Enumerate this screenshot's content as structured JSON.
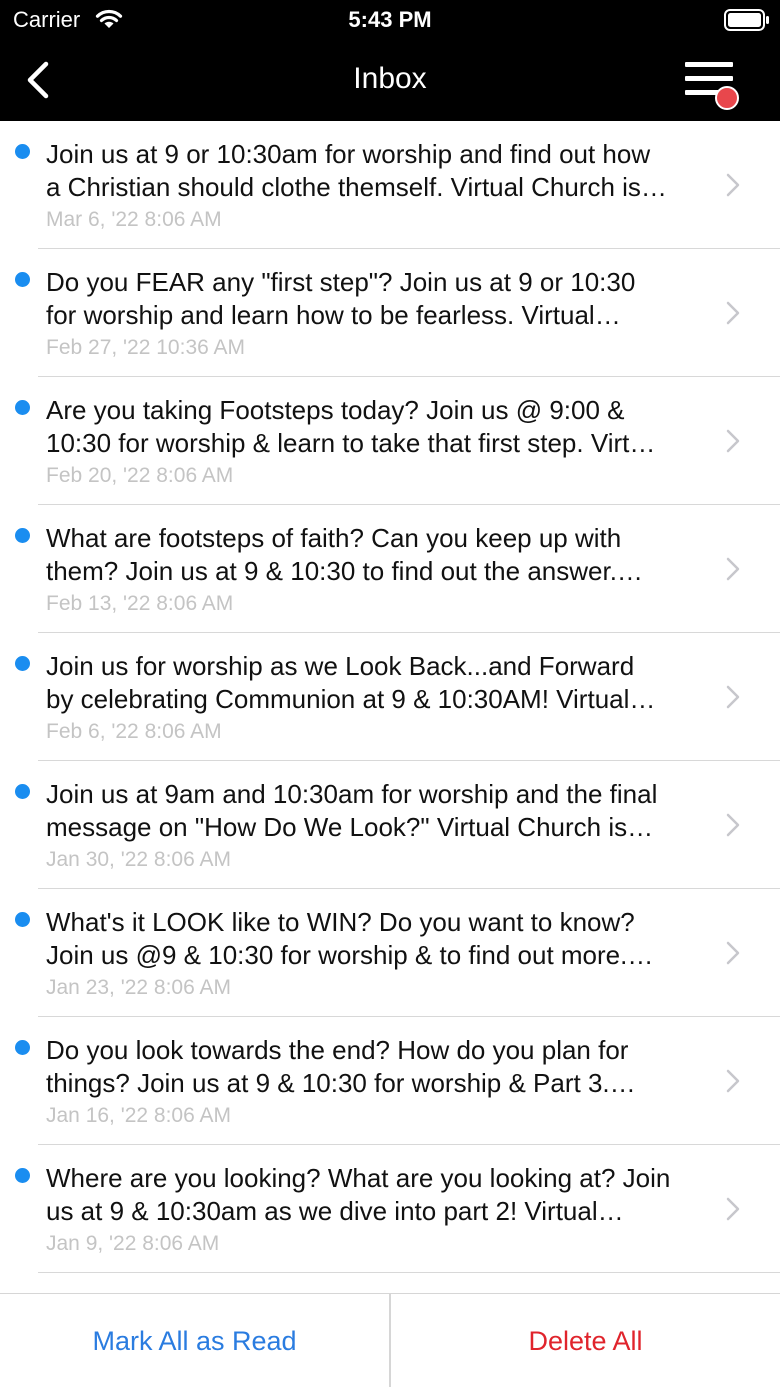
{
  "status_bar": {
    "carrier": "Carrier",
    "time": "5:43 PM"
  },
  "nav": {
    "title": "Inbox",
    "back_icon": "chevron-left-icon",
    "menu_icon": "hamburger-menu-icon"
  },
  "colors": {
    "unread_dot": "#1a8df0",
    "menu_badge": "#e8474c",
    "mark_all": "#2a7ce0",
    "delete_all": "#e0242c"
  },
  "messages": [
    {
      "line1": "Join us at 9 or 10:30am for worship and find out how",
      "line2": "a Christian should clothe themself. Virtual Church is…",
      "date": "Mar 6, '22 8:06 AM",
      "unread": true
    },
    {
      "line1": "Do you FEAR any \"first step\"? Join us at 9 or 10:30",
      "line2": "for worship and learn how to be fearless. Virtual…",
      "date": "Feb 27, '22 10:36 AM",
      "unread": true
    },
    {
      "line1": "Are you taking Footsteps today? Join us @ 9:00 &",
      "line2": "10:30 for worship & learn to take that first step. Virt…",
      "date": "Feb 20, '22 8:06 AM",
      "unread": true
    },
    {
      "line1": "What are footsteps of faith? Can you keep up with",
      "line2": "them? Join us at 9 & 10:30 to find out the answer.…",
      "date": "Feb 13, '22 8:06 AM",
      "unread": true
    },
    {
      "line1": "Join us for worship as we Look Back...and Forward",
      "line2": "by celebrating Communion at 9 & 10:30AM! Virtual…",
      "date": "Feb 6, '22 8:06 AM",
      "unread": true
    },
    {
      "line1": "Join us at 9am and 10:30am for worship and the final",
      "line2": "message on \"How Do We Look?\" Virtual Church is…",
      "date": "Jan 30, '22 8:06 AM",
      "unread": true
    },
    {
      "line1": "What's it LOOK like to WIN? Do you want to know?",
      "line2": "Join us @9 & 10:30 for worship & to find out more.…",
      "date": "Jan 23, '22 8:06 AM",
      "unread": true
    },
    {
      "line1": "Do you look towards the end? How do you plan for",
      "line2": "things? Join us at 9 & 10:30 for worship & Part 3.…",
      "date": "Jan 16, '22 8:06 AM",
      "unread": true
    },
    {
      "line1": "Where are you looking? What are you looking at? Join",
      "line2": "us at 9 & 10:30am as we dive into part 2! Virtual…",
      "date": "Jan 9, '22 8:06 AM",
      "unread": true
    }
  ],
  "actions": {
    "mark_all_read": "Mark All as Read",
    "delete_all": "Delete All"
  }
}
